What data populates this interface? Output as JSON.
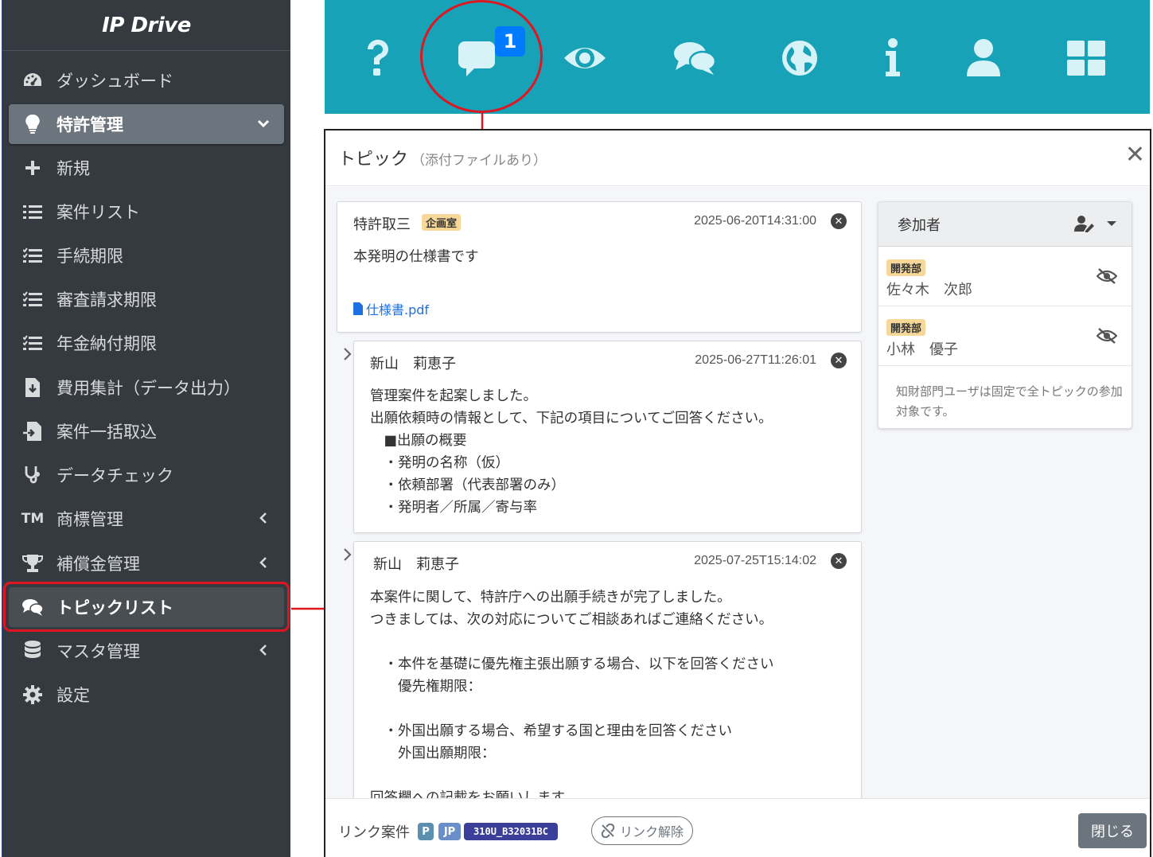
{
  "sidebar": {
    "brand": "IP Drive",
    "items": [
      {
        "label": "ダッシュボード",
        "icon": "dashboard-gauge-icon"
      },
      {
        "label": "特許管理",
        "icon": "lightbulb-icon"
      },
      {
        "label": "新規",
        "icon": "plus-icon"
      },
      {
        "label": "案件リスト",
        "icon": "list-icon"
      },
      {
        "label": "手続期限",
        "icon": "checklist-icon"
      },
      {
        "label": "審査請求期限",
        "icon": "checklist-icon"
      },
      {
        "label": "年金納付期限",
        "icon": "checklist-icon"
      },
      {
        "label": "費用集計（データ出力）",
        "icon": "file-download-icon"
      },
      {
        "label": "案件一括取込",
        "icon": "file-import-icon"
      },
      {
        "label": "データチェック",
        "icon": "stethoscope-icon"
      },
      {
        "label": "商標管理",
        "icon": "trademark-icon",
        "icon_text": "TM"
      },
      {
        "label": "補償金管理",
        "icon": "trophy-icon"
      },
      {
        "label": "トピックリスト",
        "icon": "comments-icon"
      },
      {
        "label": "マスタ管理",
        "icon": "database-icon"
      },
      {
        "label": "設定",
        "icon": "gear-icon"
      }
    ]
  },
  "topbar": {
    "comment_badge": "1",
    "icons": [
      "question-icon",
      "comment-icon",
      "eye-icon",
      "comments-icon",
      "globe-icon",
      "info-icon",
      "user-icon",
      "grid-icon"
    ]
  },
  "modal": {
    "title": "トピック",
    "subtitle": "（添付ファイルあり）",
    "close_symbol": "✕",
    "messages": [
      {
        "author": "特許取三",
        "tag": "企画室",
        "time": "2025-06-20T14:31:00",
        "text": "本発明の仕様書です",
        "attachment": "仕様書.pdf"
      },
      {
        "author": "新山　莉恵子",
        "time": "2025-06-27T11:26:01",
        "text": "管理案件を起案しました。\n出願依頼時の情報として、下記の項目についてご回答ください。\n　■出願の概要\n　・発明の名称（仮）\n　・依頼部署（代表部署のみ）\n　・発明者／所属／寄与率"
      },
      {
        "author": "新山　莉恵子",
        "time": "2025-07-25T15:14:02",
        "text": "本案件に関して、特許庁への出願手続きが完了しました。\nつきましては、次の対応についてご相談あればご連絡ください。\n\n　・本件を基礎に優先権主張出願する場合、以下を回答ください\n　　優先権期限：\n\n　・外国出願する場合、希望する国と理由を回答ください\n　　外国出願期限：\n\n回答欄への記載をお願いします。"
      }
    ],
    "participants": {
      "header": "参加者",
      "list": [
        {
          "dept": "開発部",
          "name": "佐々木　次郎"
        },
        {
          "dept": "開発部",
          "name": "小林　優子"
        }
      ],
      "note": "知財部門ユーザは固定で全トピックの参加対象です。"
    },
    "footer": {
      "link_label": "リンク案件",
      "chip_p": "P",
      "chip_jp": "JP",
      "case_id": "310U_B32031BC",
      "unlink_label": "リンク解除",
      "close_label": "閉じる"
    }
  },
  "colors": {
    "sidebar_bg": "#343a40",
    "topbar_bg": "#17a2b8",
    "highlight_red": "#e0151f",
    "badge_blue": "#007bff",
    "tag_bg": "#f6d99a"
  }
}
